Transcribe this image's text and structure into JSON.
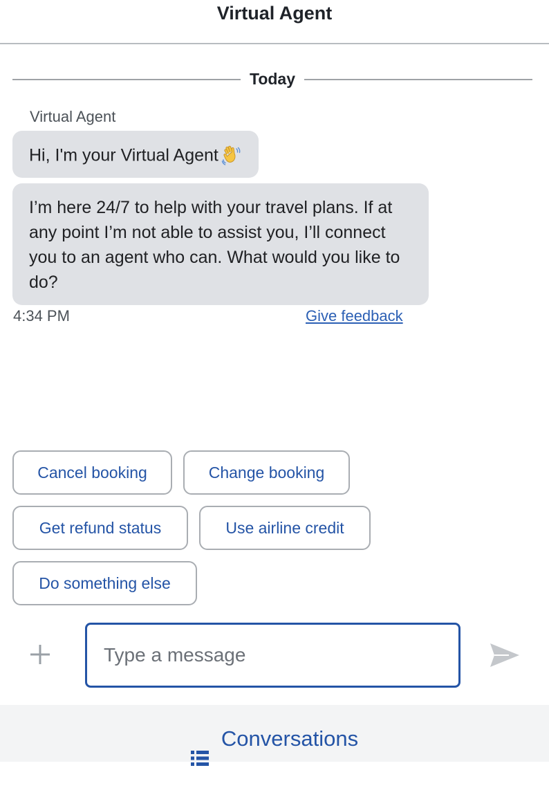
{
  "header": {
    "title": "Virtual Agent"
  },
  "divider": {
    "label": "Today"
  },
  "messages": {
    "sender": "Virtual Agent",
    "greeting": "Hi, I'm your Virtual Agent",
    "greeting_icon": "waving-hand-icon",
    "body": "I’m here 24/7 to help with your travel plans. If at any point I’m not able to assist you, I’ll connect you to an agent who can. What would you like to do?",
    "time": "4:34 PM",
    "feedback_label": "Give feedback"
  },
  "quick_replies": [
    {
      "label": "Cancel booking"
    },
    {
      "label": "Change booking"
    },
    {
      "label": "Get refund status"
    },
    {
      "label": "Use airline credit"
    },
    {
      "label": "Do something else"
    }
  ],
  "composer": {
    "placeholder": "Type a message",
    "value": "",
    "attach_icon": "plus-icon",
    "send_icon": "send-icon"
  },
  "footer": {
    "label": "Conversations",
    "icon": "list-icon"
  },
  "colors": {
    "accent": "#2454a6",
    "bubble": "#dfe1e5",
    "footer_bg": "#f3f4f5"
  }
}
